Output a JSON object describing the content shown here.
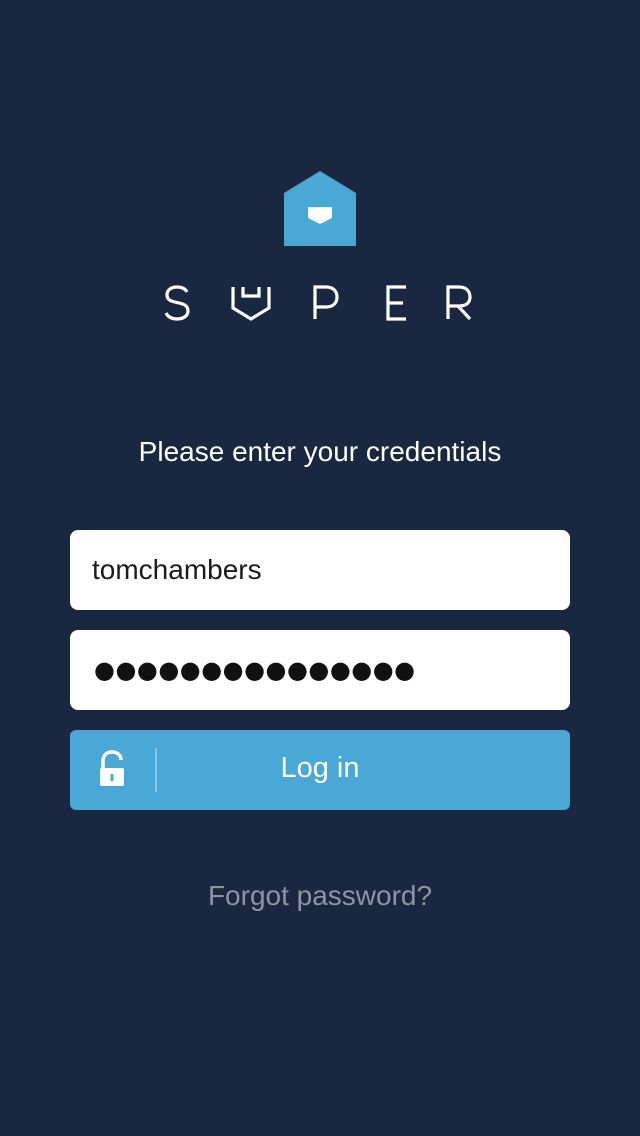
{
  "app": {
    "brand_name": "SUPER",
    "brand_color": "#49a8d6",
    "background_color": "#1a2740"
  },
  "login": {
    "prompt": "Please enter your credentials",
    "username_value": "tomchambers",
    "password_mask": "●●●●●●●●●●●●●●●",
    "login_label": "Log in",
    "login_icon": "unlock-icon",
    "forgot_label": "Forgot password?"
  }
}
